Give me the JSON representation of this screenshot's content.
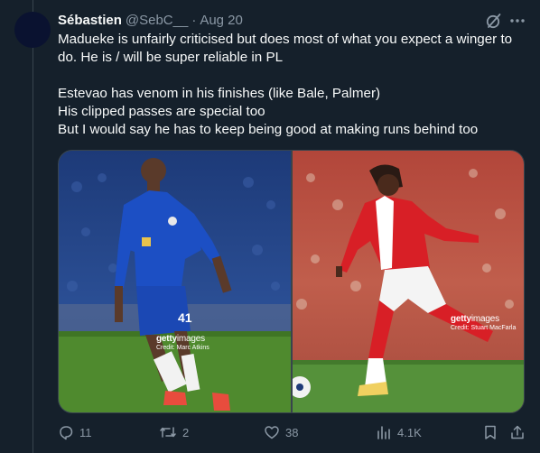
{
  "tweet": {
    "author_name": "Sébastien",
    "handle": "@SebC__",
    "separator": "·",
    "date": "Aug 20",
    "text_lines": [
      "Madueke is unfairly criticised but does most of what you expect a winger to",
      "do. He is / will be super reliable in PL",
      "",
      "Estevao has venom in his finishes (like Bale, Palmer)",
      "His clipped passes are special too",
      "But I would say he has to keep being good at making runs behind too"
    ]
  },
  "media": {
    "left": {
      "watermark_brand": "getty",
      "watermark_brand_suffix": "images",
      "credit": "Credit: Marc Atkins",
      "kit_number": "41"
    },
    "right": {
      "watermark_brand": "getty",
      "watermark_brand_suffix": "images",
      "credit": "Credit: Stuart MacFarla"
    }
  },
  "actions": {
    "replies": "11",
    "reposts": "2",
    "likes": "38",
    "views": "4.1K"
  },
  "colors": {
    "background": "#15202b",
    "text": "#f7f9f9",
    "muted": "#8b98a5",
    "border": "#38444d"
  }
}
